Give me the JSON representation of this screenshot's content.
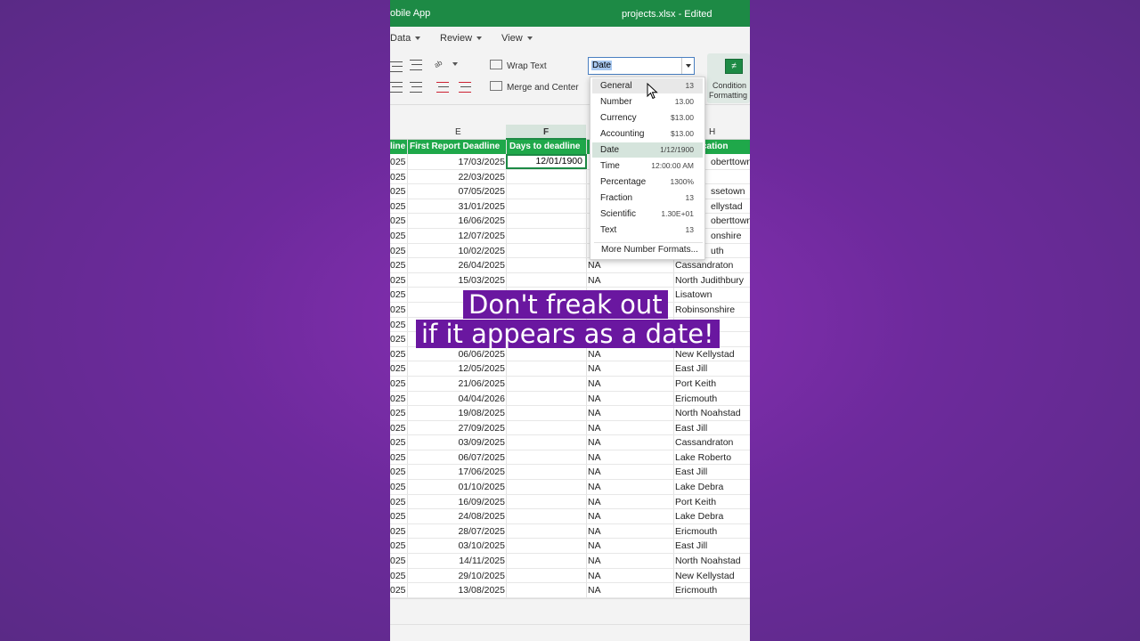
{
  "titlebar": {
    "app": "obile App",
    "file": "projects.xlsx - Edited"
  },
  "menu": {
    "data": "Data",
    "review": "Review",
    "view": "View"
  },
  "ribbon": {
    "wrap_text": "Wrap Text",
    "merge_center": "Merge and Center",
    "cond_fmt_1": "Condition",
    "cond_fmt_2": "Formatting"
  },
  "format_box": {
    "value": "Date"
  },
  "columns": {
    "e": "E",
    "f": "F",
    "h": "H"
  },
  "headers": {
    "d": "line",
    "e": "First Report Deadline",
    "f": "Days to deadline",
    "h": "cation"
  },
  "selected_cell": "12/01/1900",
  "rows": [
    {
      "a": "025",
      "e": "17/03/2025",
      "g": "",
      "h": ""
    },
    {
      "a": "025",
      "e": "22/03/2025",
      "g": "",
      "h": ""
    },
    {
      "a": "025",
      "e": "07/05/2025",
      "g": "",
      "h": ""
    },
    {
      "a": "025",
      "e": "31/01/2025",
      "g": "",
      "h": ""
    },
    {
      "a": "025",
      "e": "16/06/2025",
      "g": "",
      "h": ""
    },
    {
      "a": "025",
      "e": "12/07/2025",
      "g": "",
      "h": ""
    },
    {
      "a": "025",
      "e": "10/02/2025",
      "g": "",
      "h": ""
    },
    {
      "a": "025",
      "e": "26/04/2025",
      "g": "NA",
      "h": "Cassandraton"
    },
    {
      "a": "025",
      "e": "15/03/2025",
      "g": "NA",
      "h": "North Judithbury"
    },
    {
      "a": "025",
      "e": "26",
      "g": "",
      "h": "Lisatown"
    },
    {
      "a": "025",
      "e": "10",
      "g": "",
      "h": "Robinsonshire"
    },
    {
      "a": "025",
      "e": "",
      "g": "",
      "h": "stad"
    },
    {
      "a": "025",
      "e": "",
      "g": "",
      "h": ""
    },
    {
      "a": "025",
      "e": "06/06/2025",
      "g": "NA",
      "h": "New Kellystad"
    },
    {
      "a": "025",
      "e": "12/05/2025",
      "g": "NA",
      "h": "East Jill"
    },
    {
      "a": "025",
      "e": "21/06/2025",
      "g": "NA",
      "h": "Port Keith"
    },
    {
      "a": "025",
      "e": "04/04/2026",
      "g": "NA",
      "h": "Ericmouth"
    },
    {
      "a": "025",
      "e": "19/08/2025",
      "g": "NA",
      "h": "North Noahstad"
    },
    {
      "a": "025",
      "e": "27/09/2025",
      "g": "NA",
      "h": "East Jill"
    },
    {
      "a": "025",
      "e": "03/09/2025",
      "g": "NA",
      "h": "Cassandraton"
    },
    {
      "a": "025",
      "e": "06/07/2025",
      "g": "NA",
      "h": "Lake Roberto"
    },
    {
      "a": "025",
      "e": "17/06/2025",
      "g": "NA",
      "h": "East Jill"
    },
    {
      "a": "025",
      "e": "01/10/2025",
      "g": "NA",
      "h": "Lake Debra"
    },
    {
      "a": "025",
      "e": "16/09/2025",
      "g": "NA",
      "h": "Port Keith"
    },
    {
      "a": "025",
      "e": "24/08/2025",
      "g": "NA",
      "h": "Lake Debra"
    },
    {
      "a": "025",
      "e": "28/07/2025",
      "g": "NA",
      "h": "Ericmouth"
    },
    {
      "a": "025",
      "e": "03/10/2025",
      "g": "NA",
      "h": "East Jill"
    },
    {
      "a": "025",
      "e": "14/11/2025",
      "g": "NA",
      "h": "North Noahstad"
    },
    {
      "a": "025",
      "e": "29/10/2025",
      "g": "NA",
      "h": "New Kellystad"
    },
    {
      "a": "025",
      "e": "13/08/2025",
      "g": "NA",
      "h": "Ericmouth"
    }
  ],
  "partial_h": [
    "oberttown",
    "",
    "ssetown",
    "ellystad",
    "oberttown",
    "onshire",
    "uth"
  ],
  "dropdown": {
    "items": [
      {
        "name": "General",
        "sample": "13"
      },
      {
        "name": "Number",
        "sample": "13.00"
      },
      {
        "name": "Currency",
        "sample": "$13.00"
      },
      {
        "name": "Accounting",
        "sample": "$13.00"
      },
      {
        "name": "Date",
        "sample": "1/12/1900"
      },
      {
        "name": "Time",
        "sample": "12:00:00 AM"
      },
      {
        "name": "Percentage",
        "sample": "1300%"
      },
      {
        "name": "Fraction",
        "sample": "13"
      },
      {
        "name": "Scientific",
        "sample": "1.30E+01"
      },
      {
        "name": "Text",
        "sample": "13"
      }
    ],
    "more": "More Number Formats..."
  },
  "caption": {
    "line1": "Don't freak out",
    "line2": "if it appears as a date!"
  },
  "colors": {
    "excel_green": "#1d8a45",
    "header_green": "#1fa84a",
    "caption_bg": "#6a17a0"
  }
}
